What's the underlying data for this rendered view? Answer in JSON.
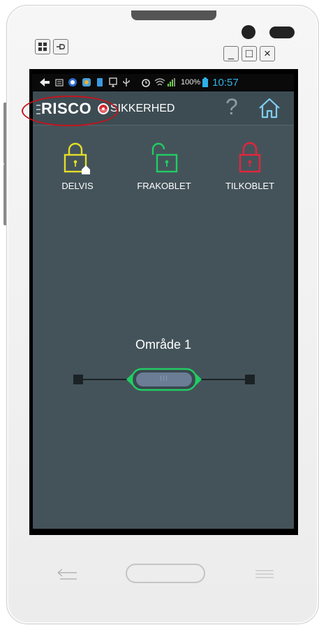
{
  "status_bar": {
    "battery": "100%",
    "time": "10:57"
  },
  "app_bar": {
    "logo": "RISCO",
    "title": "SIKKERHED",
    "help": "?"
  },
  "locks": [
    {
      "label": "DELVIS",
      "color": "#e3de28"
    },
    {
      "label": "FRAKOBLET",
      "color": "#21cc63"
    },
    {
      "label": "TILKOBLET",
      "color": "#e2263c"
    }
  ],
  "area": {
    "name": "Område 1",
    "grip": "III"
  },
  "window_buttons": {
    "minimize": "_",
    "maximize": "□",
    "close": "×"
  },
  "colors": {
    "app_background": "#44535a",
    "slider_green": "#21cc63",
    "annotation_red": "#c3141d"
  }
}
